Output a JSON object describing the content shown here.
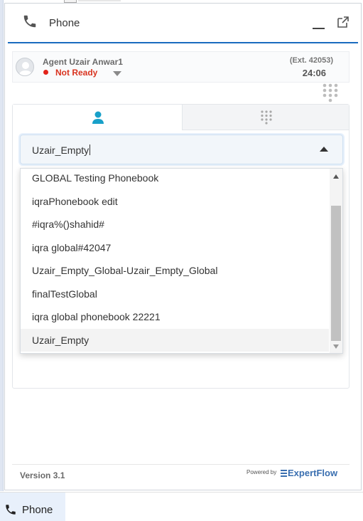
{
  "header": {
    "title": "Phone"
  },
  "agent": {
    "name": "Agent Uzair Anwar1",
    "status": "Not Ready",
    "extension": "(Ext. 42053)",
    "timer": "24:06"
  },
  "colors": {
    "accent": "#1a6bbf",
    "status_not_ready": "#e2231a",
    "brand": "#3a6fb0"
  },
  "phonebook_select": {
    "value": "Uzair_Empty"
  },
  "dropdown": {
    "options": [
      {
        "label": "GLOBAL Testing Phonebook"
      },
      {
        "label": "iqraPhonebook edit"
      },
      {
        "label": "#iqra%()shahid#"
      },
      {
        "label": "iqra global#42047"
      },
      {
        "label": "Uzair_Empty_Global-Uzair_Empty_Global"
      },
      {
        "label": "finalTestGlobal"
      },
      {
        "label": "iqra global phonebook 22221"
      },
      {
        "label": "Uzair_Empty"
      }
    ],
    "selected": "Uzair_Empty"
  },
  "footer": {
    "version": "Version 3.1",
    "powered_by": "Powered by",
    "brand": "ExpertFlow"
  },
  "taskbar": {
    "label": "Phone"
  },
  "icons": [
    "phone-icon",
    "minimize-icon",
    "popout-icon",
    "avatar-icon",
    "dialpad-icon",
    "contact-icon"
  ]
}
